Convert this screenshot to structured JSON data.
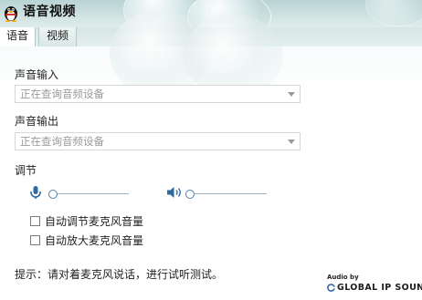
{
  "window": {
    "title": "语音视频"
  },
  "tabs": [
    {
      "label": "语音",
      "active": true
    },
    {
      "label": "视频",
      "active": false
    }
  ],
  "audio_input": {
    "label": "声音输入",
    "value": "正在查询音频设备"
  },
  "audio_output": {
    "label": "声音输出",
    "value": "正在查询音频设备"
  },
  "adjust": {
    "label": "调节",
    "mic_icon": "microphone-icon",
    "speaker_icon": "speaker-icon",
    "mic_level": 0,
    "speaker_level": 0
  },
  "options": [
    {
      "label": "自动调节麦克风音量",
      "checked": false
    },
    {
      "label": "自动放大麦克风音量",
      "checked": false
    }
  ],
  "tip": "提示：请对着麦克风说话，进行试听测试。",
  "brand": {
    "small_text": "Audio by",
    "name": "GLOBAL IP SOUND"
  },
  "colors": {
    "accent": "#2f6aa3",
    "titlebar": "#c6dcdb"
  }
}
